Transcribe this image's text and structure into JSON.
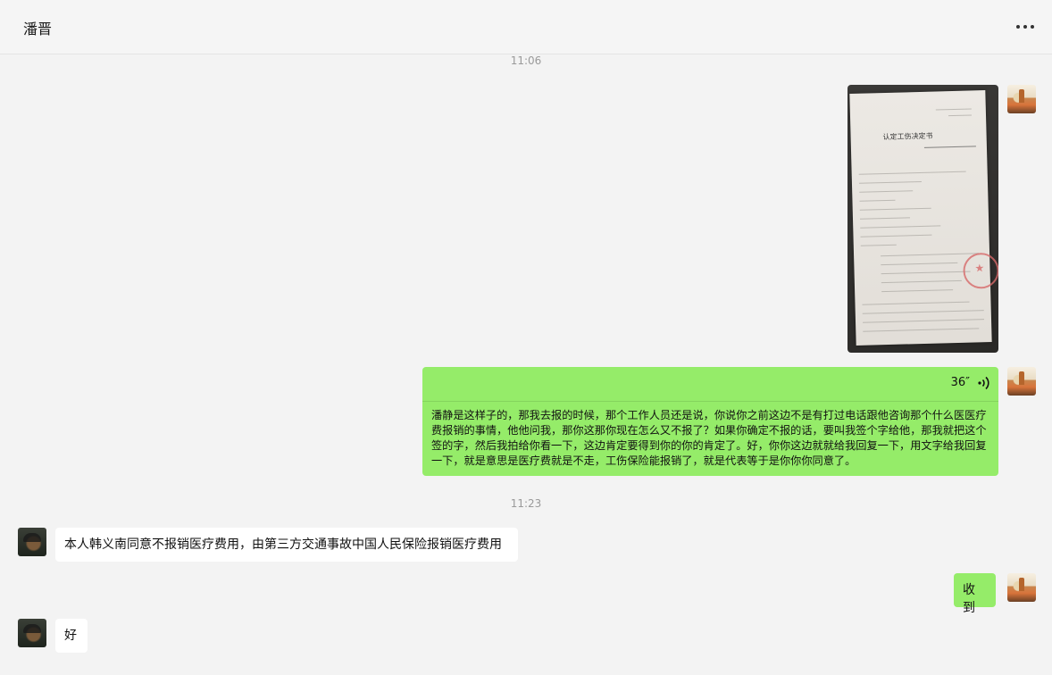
{
  "header": {
    "title": "潘晋",
    "more_icon": "more-horizontal-icon"
  },
  "messages": {
    "time1": "11:06",
    "voice": {
      "duration": "36″",
      "transcript": "潘静是这样子的，那我去报的时候，那个工作人员还是说，你说你之前这边不是有打过电话跟他咨询那个什么医医疗费报销的事情，他他问我，那你这那你现在怎么又不报了？如果你确定不报的话，要叫我签个字给他，那我就把这个签的字，然后我拍给你看一下，这边肯定要得到你的你的肯定了。好，你你这边就就给我回复一下，用文字给我回复一下，就是意思是医疗费就是不走，工伤保险能报销了，就是代表等于是你你你同意了。"
    },
    "image": {
      "doc_title": "认定工伤决定书"
    },
    "time2": "11:23",
    "incoming1": "本人韩义南同意不报销医疗费用，由第三方交通事故中国人民保险报销医疗费用",
    "outgoing1": "收到",
    "incoming2": "好"
  },
  "colors": {
    "outgoing_bubble": "#95ec69",
    "incoming_bubble": "#ffffff",
    "background": "#f3f3f3"
  }
}
